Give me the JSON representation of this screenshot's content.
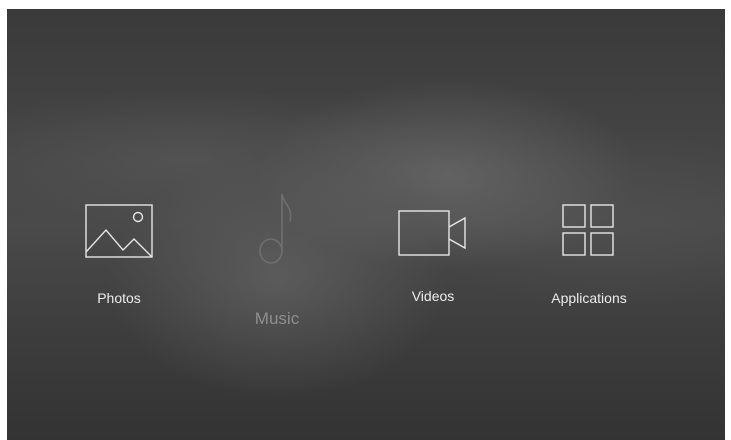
{
  "home": {
    "tiles": [
      {
        "label": "Photos",
        "icon": "image-icon",
        "focused": false
      },
      {
        "label": "Music",
        "icon": "music-note-icon",
        "focused": true
      },
      {
        "label": "Videos",
        "icon": "video-camera-icon",
        "focused": false
      },
      {
        "label": "Applications",
        "icon": "app-grid-icon",
        "focused": false
      }
    ]
  },
  "colors": {
    "label": "#ececec",
    "focused_label": "#8f8f8f",
    "icon_stroke": "#e6e6e6",
    "background_dark": "#333333"
  }
}
